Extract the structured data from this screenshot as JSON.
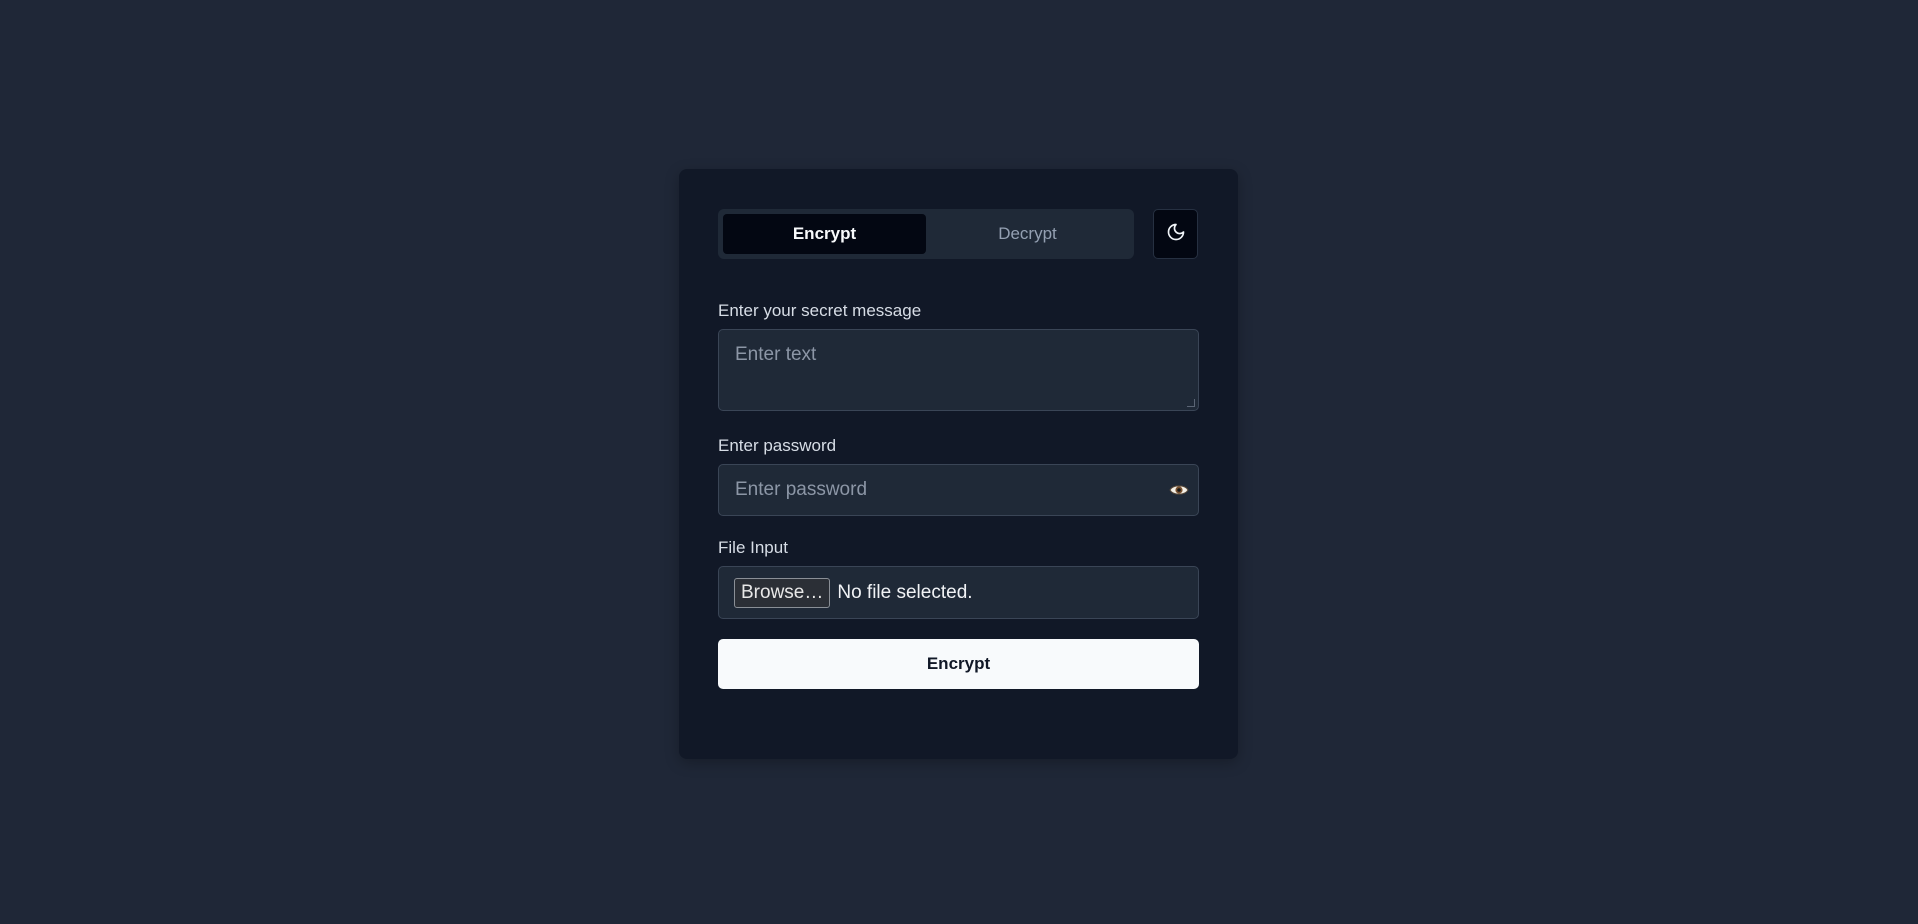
{
  "tabs": [
    {
      "label": "Encrypt",
      "active": true
    },
    {
      "label": "Decrypt",
      "active": false
    }
  ],
  "theme_toggle": {
    "icon": "moon-icon"
  },
  "message_field": {
    "label": "Enter your secret message",
    "placeholder": "Enter text"
  },
  "password_field": {
    "label": "Enter password",
    "placeholder": "Enter password",
    "toggle_icon": "eye-icon"
  },
  "file_field": {
    "label": "File Input",
    "browse_label": "Browse…",
    "status": "No file selected."
  },
  "submit": {
    "label": "Encrypt"
  },
  "colors": {
    "page_bg": "#1f2737",
    "card_bg": "#111827",
    "input_bg": "#1f2937",
    "primary_button": "#f8fafc"
  }
}
